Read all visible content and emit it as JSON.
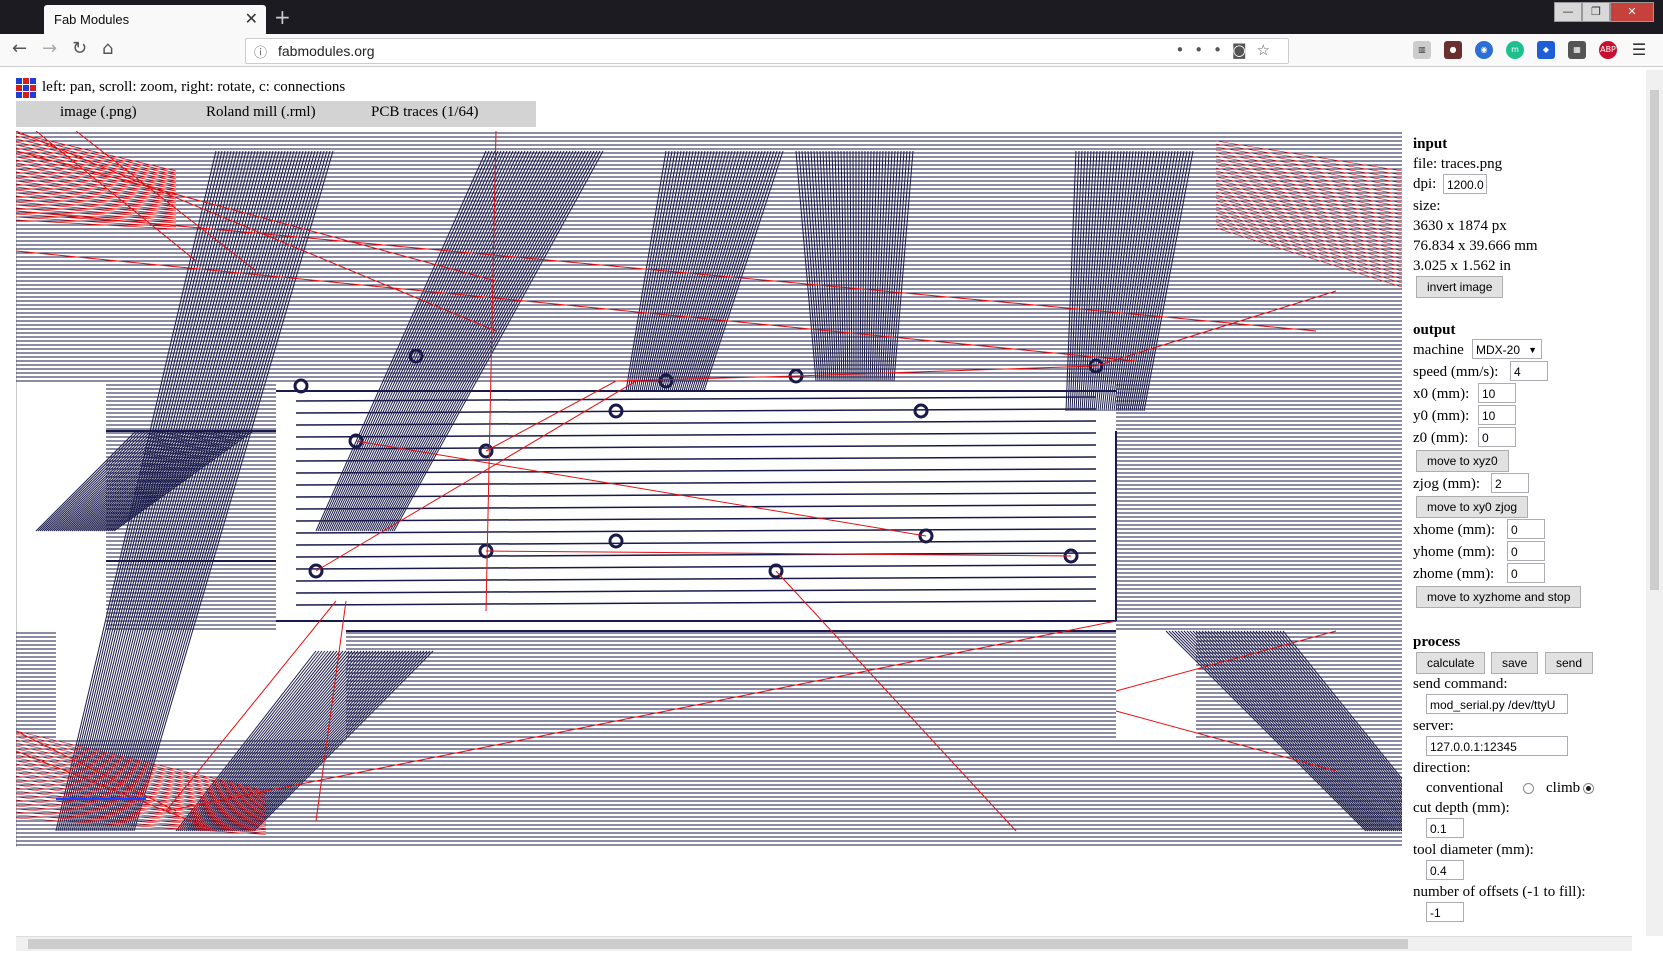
{
  "browser": {
    "tab_title": "Fab Modules",
    "tab_close": "✕",
    "new_tab": "+",
    "url": "fabmodules.org",
    "win_min": "—",
    "win_max": "❐",
    "win_close": "✕"
  },
  "page": {
    "hint": "left: pan, scroll: zoom, right: rotate, c: connections",
    "tabs": [
      "image (.png)",
      "Roland mill (.rml)",
      "PCB traces (1/64)"
    ]
  },
  "panel": {
    "input": {
      "heading": "input",
      "file": "file: traces.png",
      "dpi_label": "dpi:",
      "dpi_value": "1200.0",
      "size_label": "size:",
      "size_px": "3630 x 1874 px",
      "size_mm": "76.834 x 39.666 mm",
      "size_in": "3.025 x 1.562 in",
      "invert_button": "invert image"
    },
    "output": {
      "heading": "output",
      "machine_label": "machine",
      "machine_value": "MDX-20",
      "speed_label": "speed (mm/s):",
      "speed_value": "4",
      "x0_label": "x0 (mm):",
      "x0_value": "10",
      "y0_label": "y0 (mm):",
      "y0_value": "10",
      "z0_label": "z0 (mm):",
      "z0_value": "0",
      "move_xyz0": "move to xyz0",
      "zjog_label": "zjog (mm):",
      "zjog_value": "2",
      "move_xy0_zjog": "move to xy0 zjog",
      "xhome_label": "xhome (mm):",
      "xhome_value": "0",
      "yhome_label": "yhome (mm):",
      "yhome_value": "0",
      "zhome_label": "zhome (mm):",
      "zhome_value": "0",
      "move_home": "move to xyzhome and stop"
    },
    "process": {
      "heading": "process",
      "calculate": "calculate",
      "save": "save",
      "send": "send",
      "send_command_label": "send command:",
      "send_command_value": "mod_serial.py /dev/ttyU",
      "server_label": "server:",
      "server_value": "127.0.0.1:12345",
      "direction_label": "direction:",
      "conventional": "conventional",
      "climb": "climb",
      "direction_selected": "climb",
      "cut_depth_label": "cut depth (mm):",
      "cut_depth_value": "0.1",
      "tool_diameter_label": "tool diameter (mm):",
      "tool_diameter_value": "0.4",
      "offsets_label": "number of offsets (-1 to fill):",
      "offsets_value": "-1"
    }
  },
  "colors": {
    "toolpath": "#1a1a4a",
    "connection": "#e81010",
    "chrome_dark": "#1c1b22"
  },
  "icons": [
    "back-icon",
    "forward-icon",
    "reload-icon",
    "home-icon",
    "info-icon",
    "more-icon",
    "pocket-icon",
    "star-icon",
    "reader-icon",
    "menu-icon"
  ]
}
